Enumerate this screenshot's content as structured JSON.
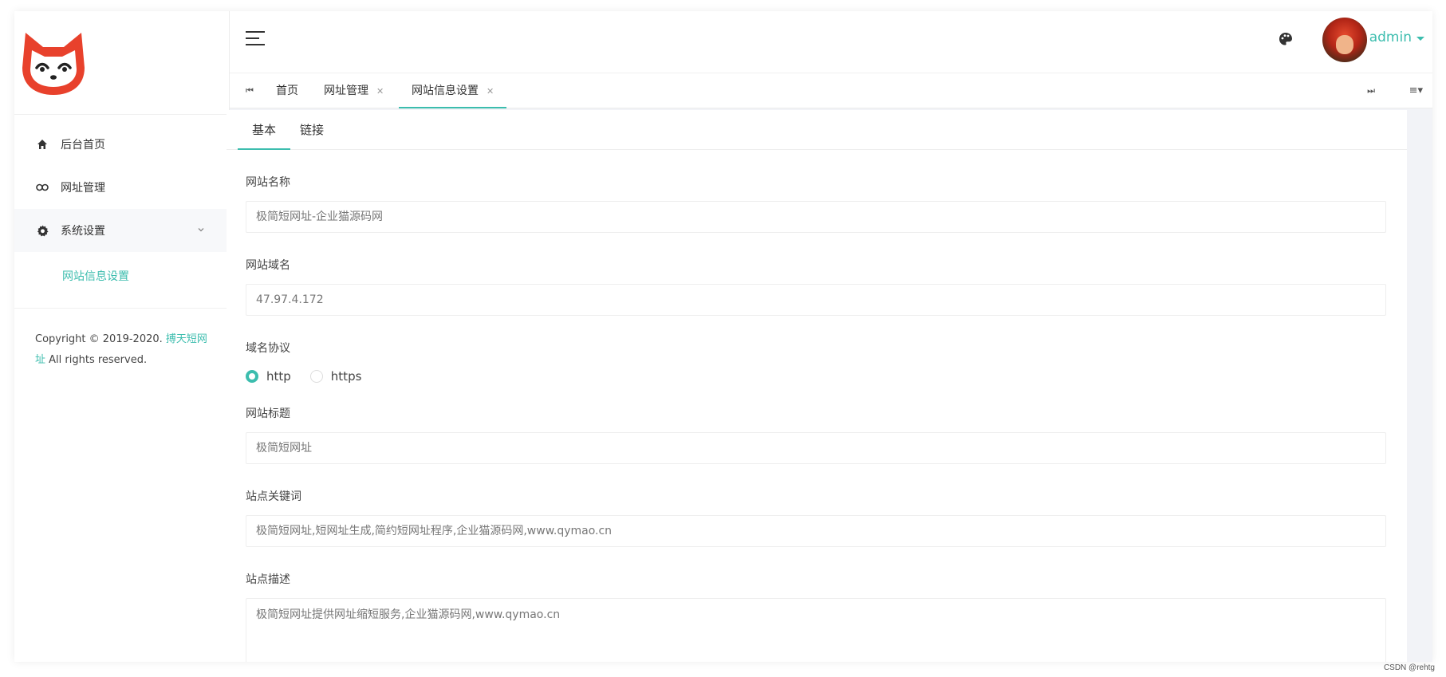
{
  "sidebar": {
    "items": [
      {
        "label": "后台首页",
        "icon": "home-icon"
      },
      {
        "label": "网址管理",
        "icon": "link-icon"
      },
      {
        "label": "系统设置",
        "icon": "gear-icon"
      }
    ],
    "sub_items": [
      {
        "label": "网站信息设置"
      }
    ],
    "copyright_prefix": "Copyright © 2019-2020.",
    "copyright_brand": "搏天短网址",
    "copyright_suffix": "All rights reserved."
  },
  "header": {
    "username": "admin"
  },
  "tabs": {
    "items": [
      {
        "label": "首页"
      },
      {
        "label": "网址管理"
      },
      {
        "label": "网站信息设置"
      }
    ],
    "first_icon": "⏮",
    "last_icon": "⏭",
    "menu_icon": "≡▾"
  },
  "form": {
    "tabs": [
      {
        "label": "基本"
      },
      {
        "label": "链接"
      }
    ],
    "site_name_label": "网站名称",
    "site_name_value": "极简短网址-企业猫源码网",
    "domain_label": "网站域名",
    "domain_value": "47.97.4.172",
    "protocol_label": "域名协议",
    "protocol_options": [
      "http",
      "https"
    ],
    "protocol_selected": "http",
    "title_label": "网站标题",
    "title_value": "极简短网址",
    "keywords_label": "站点关键词",
    "keywords_value": "极简短网址,短网址生成,简约短网址程序,企业猫源码网,www.qymao.cn",
    "description_label": "站点描述",
    "description_value": "极简短网址提供网址缩短服务,企业猫源码网,www.qymao.cn"
  },
  "watermark": "CSDN @rehtg",
  "colors": {
    "accent": "#3cbdae",
    "logo": "#e8412c"
  }
}
